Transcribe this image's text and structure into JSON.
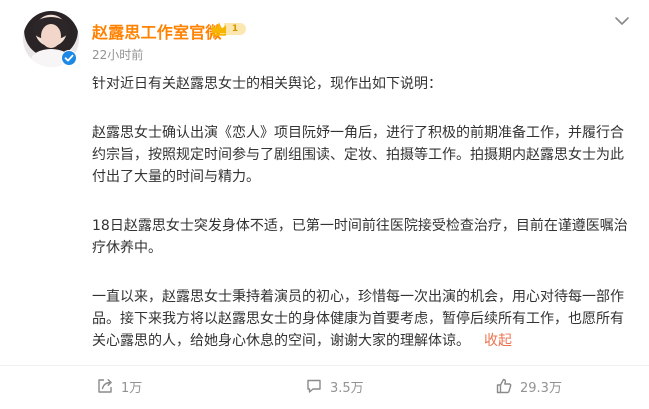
{
  "post": {
    "author_name": "赵露思工作室官微",
    "vip_level": "1",
    "timestamp": "22小时前",
    "paragraphs": [
      "针对近日有关赵露思女士的相关舆论，现作出如下说明：",
      "赵露思女士确认出演《恋人》项目阮妤一角后，进行了积极的前期准备工作，并履行合约宗旨，按照规定时间参与了剧组围读、定妆、拍摄等工作。拍摄期内赵露思女士为此付出了大量的时间与精力。",
      "18日赵露思女士突发身体不适，已第一时间前往医院接受检查治疗，目前在谨遵医嘱治疗休养中。",
      "一直以来，赵露思女士秉持着演员的初心，珍惜每一次出演的机会，用心对待每一部作品。接下来我方将以赵露思女士的身体健康为首要考虑，暂停后续所有工作，也愿所有关心露思的人，给她身心休息的空间，谢谢大家的理解体谅。"
    ],
    "collapse_label": "收起"
  },
  "actions": {
    "repost_count": "1万",
    "comment_count": "3.5万",
    "like_count": "29.3万"
  },
  "colors": {
    "author_name": "#ff8200",
    "collapse_link": "#eb7350",
    "meta_gray": "#939393",
    "verified_blue": "#1e88e5"
  },
  "icons": [
    "more-chevron-icon",
    "verified-icon",
    "vip-crown-icon",
    "repost-icon",
    "comment-icon",
    "like-icon"
  ]
}
